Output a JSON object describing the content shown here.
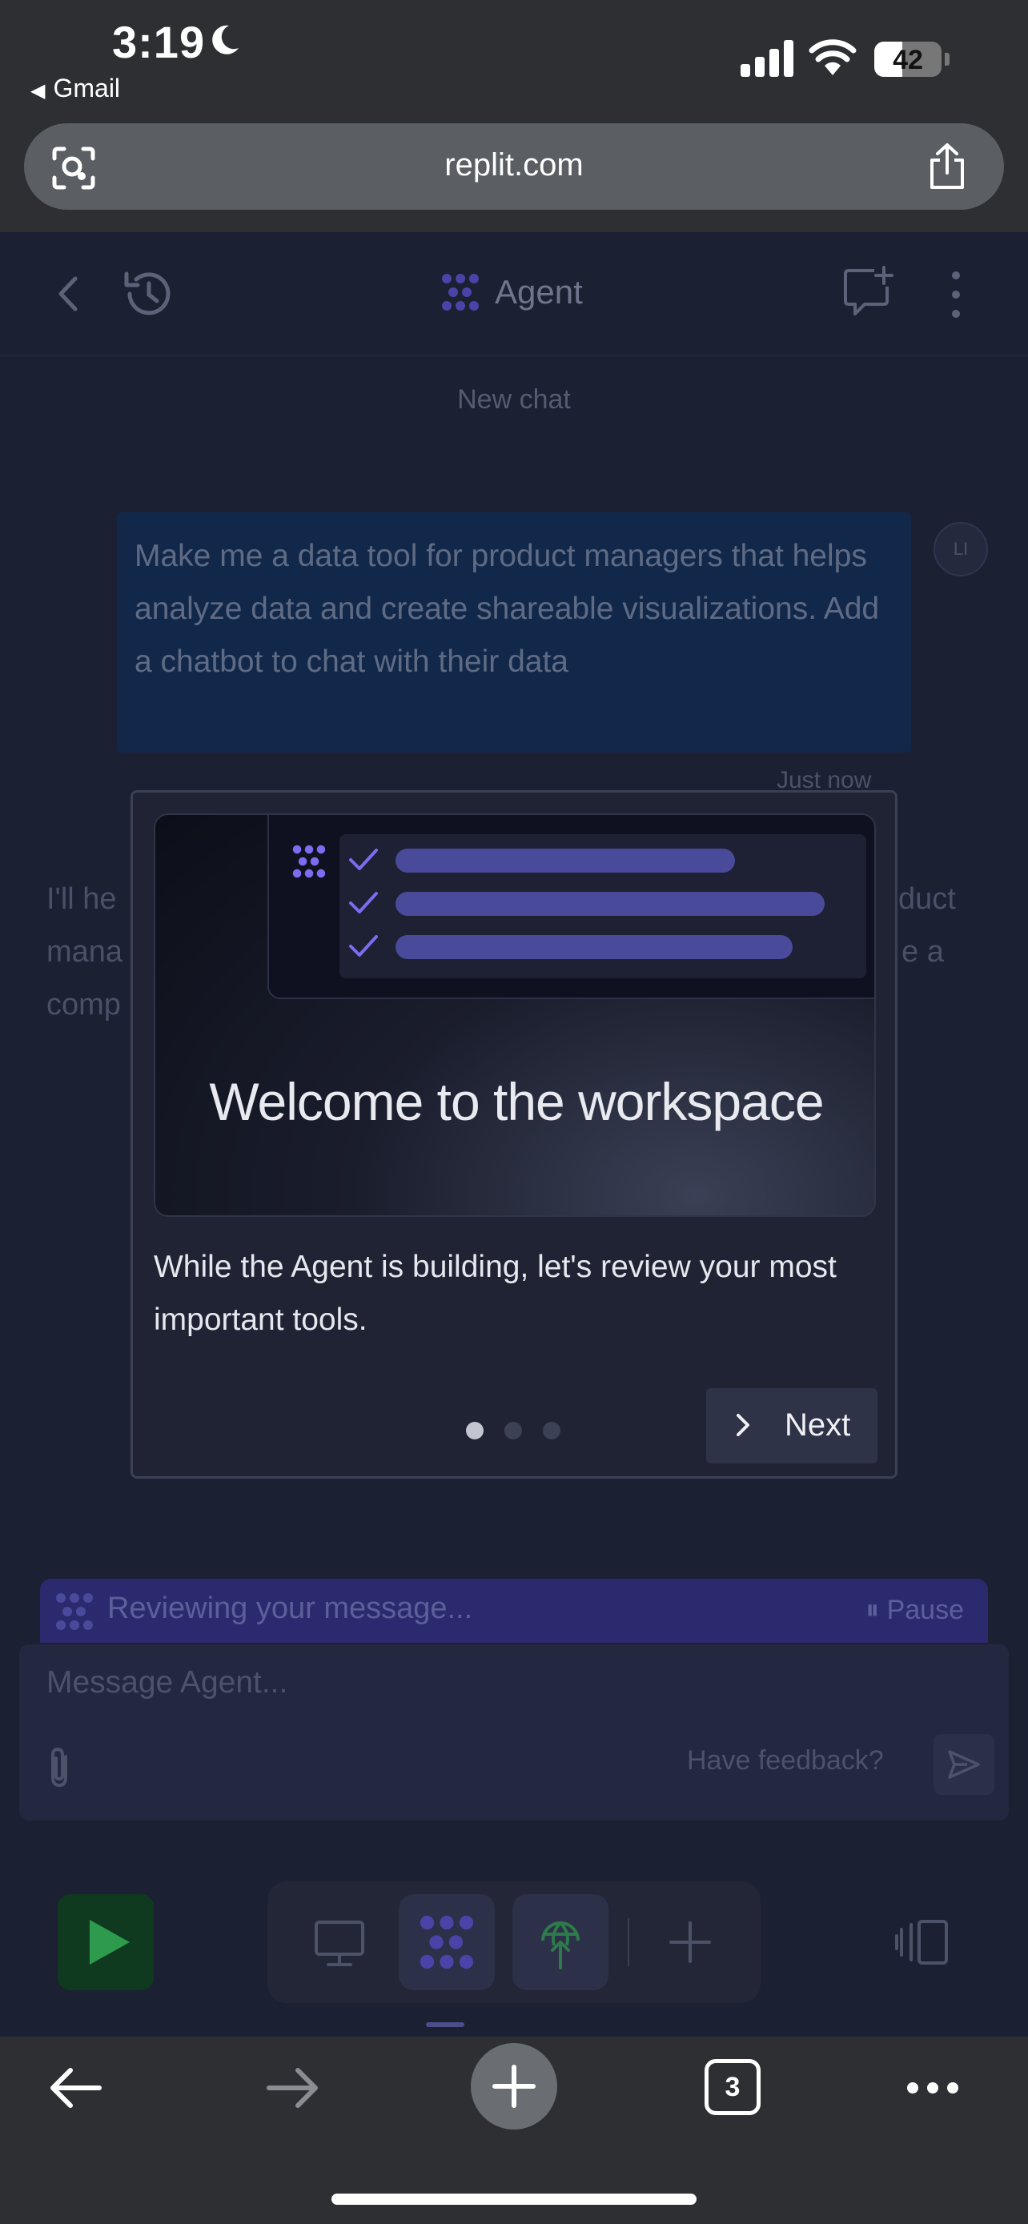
{
  "status_bar": {
    "time": "3:19",
    "back_app": "Gmail",
    "battery": "42",
    "battery_level": 0.42
  },
  "browser": {
    "url": "replit.com",
    "tab_count": "3"
  },
  "header": {
    "title": "Agent"
  },
  "chat": {
    "section_label": "New chat",
    "user_message": "Make me a data tool for product managers that helps analyze data and create shareable visualizations. Add a chatbot to chat with their data",
    "user_avatar": "LI",
    "timestamp": "Just now",
    "agent_reply_line1_start": "I'll he",
    "agent_reply_line1_end": "duct",
    "agent_reply_line2_start": "mana",
    "agent_reply_line2_end": "e a",
    "agent_reply_line3_start": "comp"
  },
  "modal": {
    "heading": "Welcome to the workspace",
    "body": "While the Agent is building, let's review your most important tools.",
    "next_label": "Next",
    "step_current": 1,
    "step_total": 3
  },
  "status_strip": {
    "text": "Reviewing your message...",
    "pause_label": "Pause"
  },
  "composer": {
    "placeholder": "Message Agent...",
    "feedback_label": "Have feedback?"
  },
  "colors": {
    "accent_purple": "#7b6cf0",
    "run_green": "#2e9a4e",
    "app_bg": "#1c2033"
  }
}
